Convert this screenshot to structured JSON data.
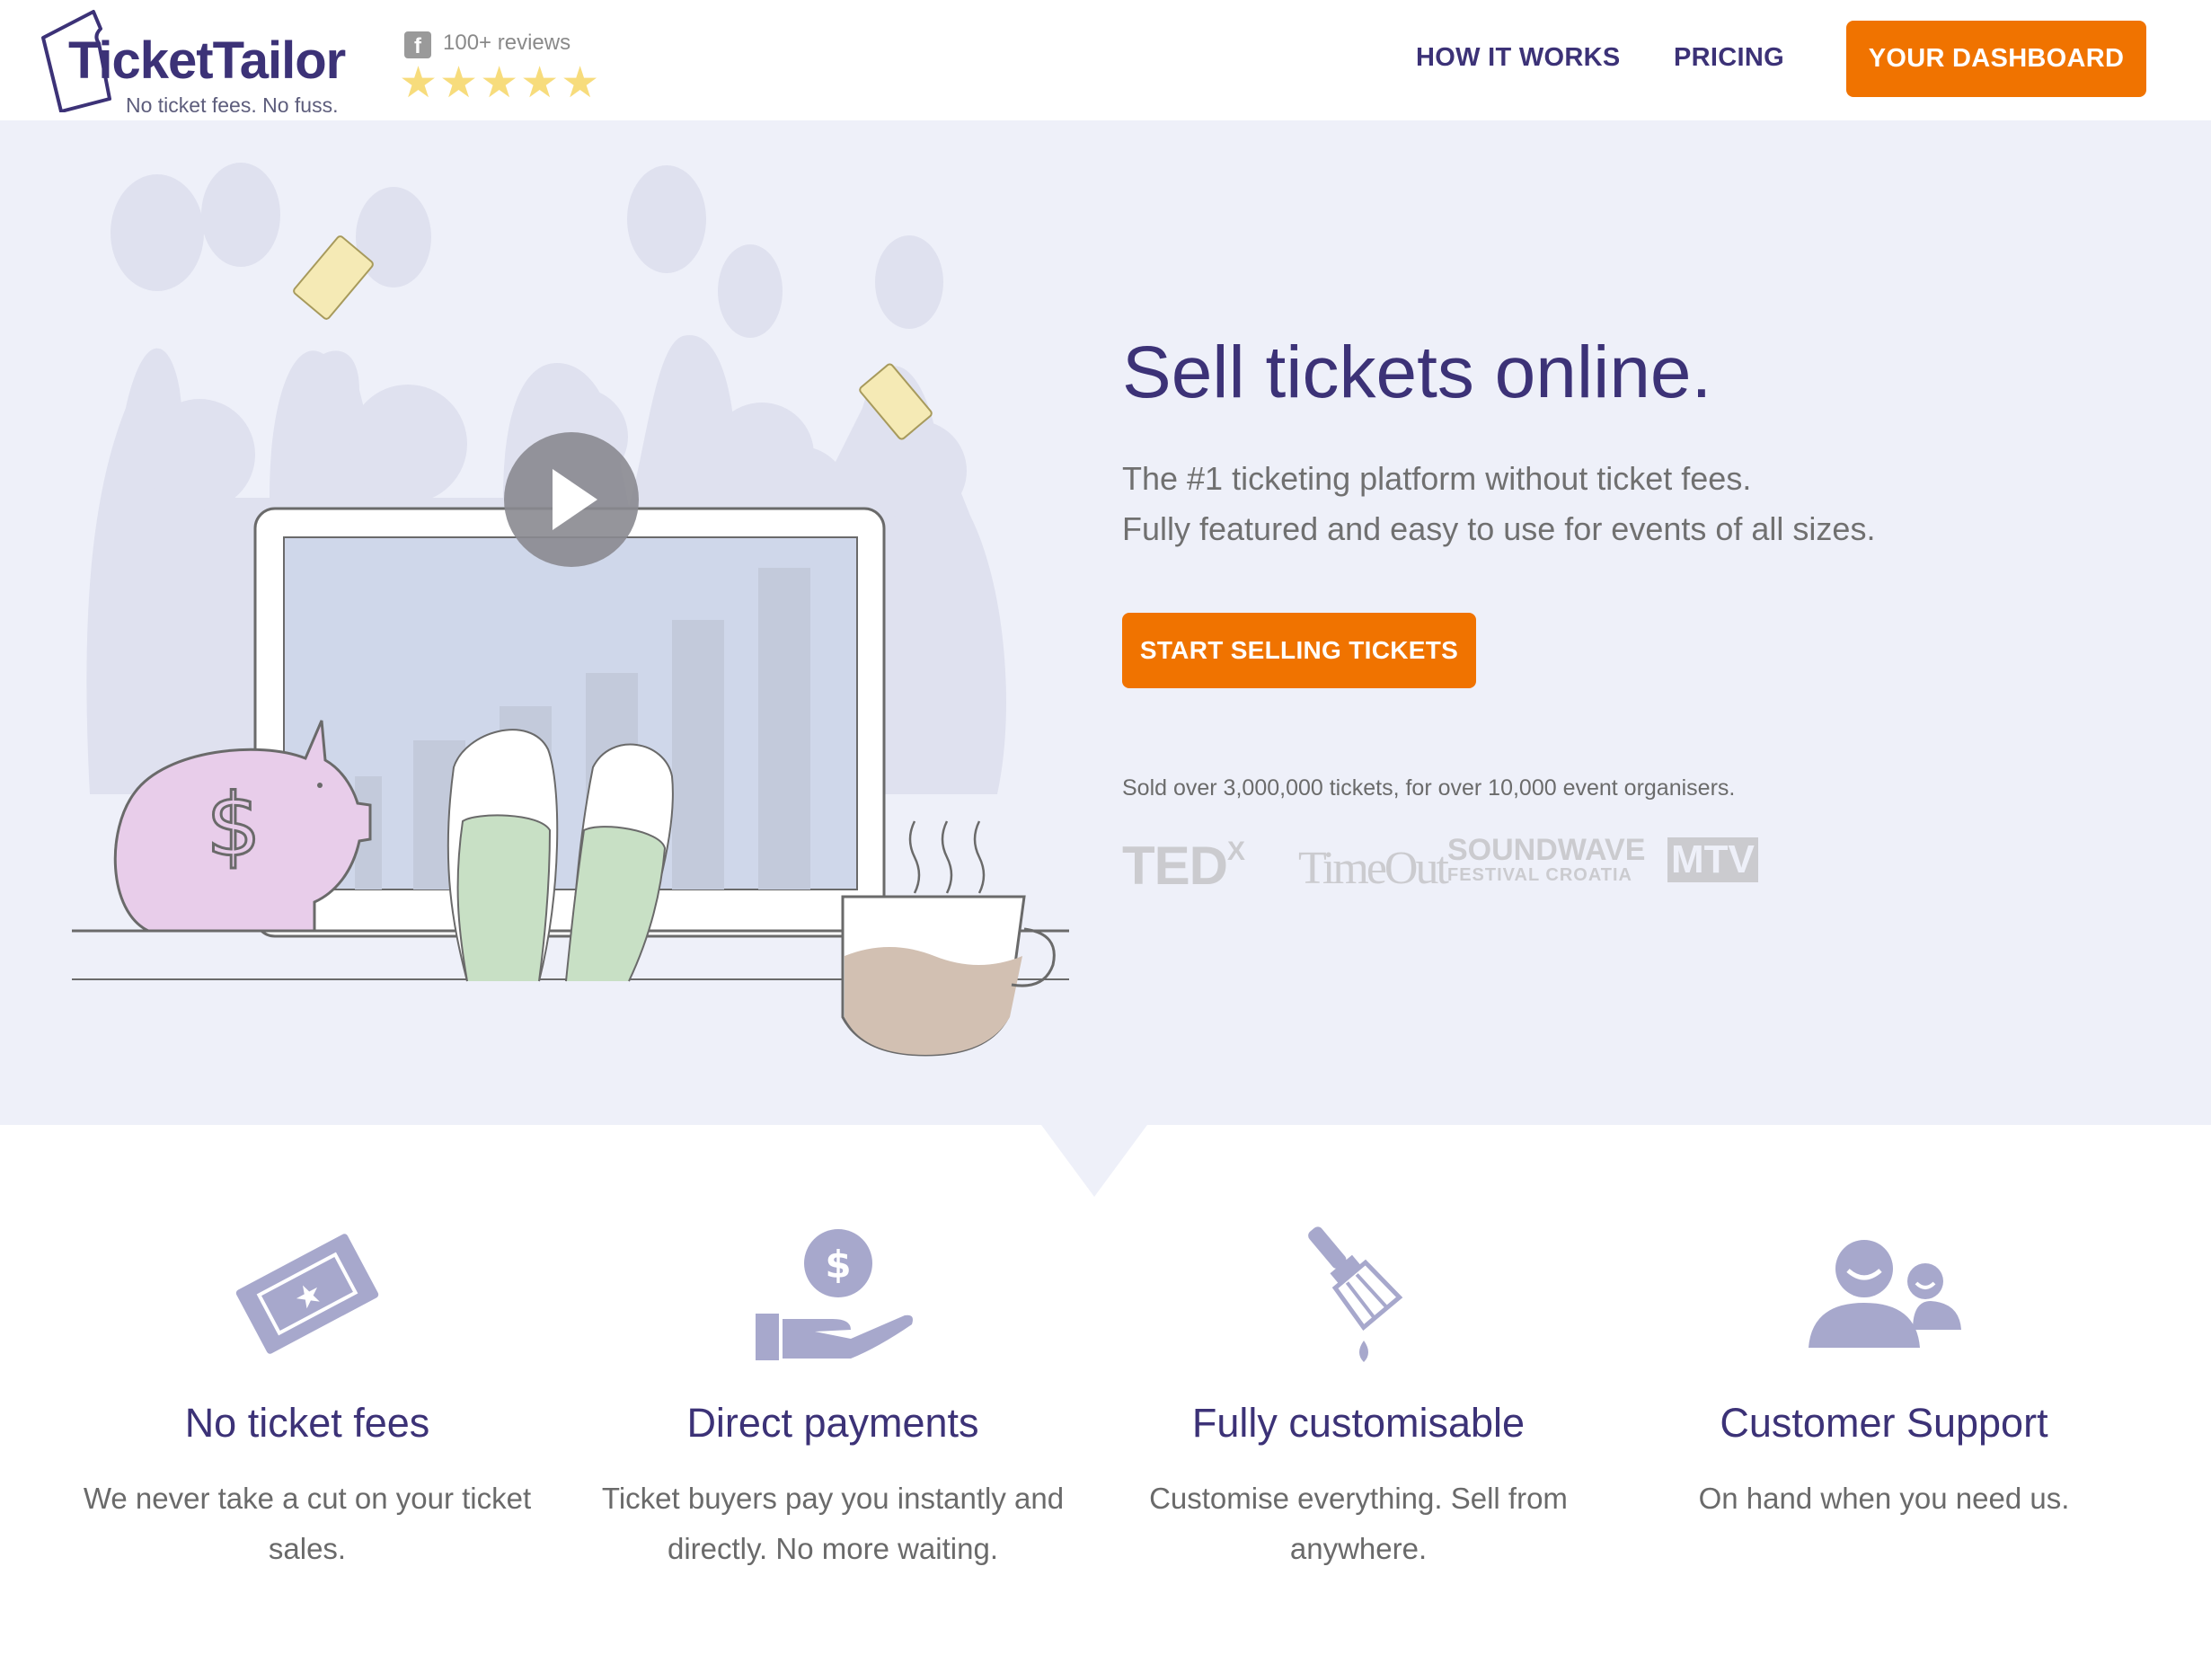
{
  "header": {
    "logo_name": "TicketTailor",
    "logo_tagline": "No ticket fees. No fuss.",
    "reviews_label": "100+ reviews",
    "facebook_glyph": "f",
    "stars": "★★★★★",
    "rating_stars": 5,
    "nav": {
      "how_it_works": "HOW IT WORKS",
      "pricing": "PRICING",
      "dashboard": "YOUR DASHBOARD"
    }
  },
  "hero": {
    "title": "Sell tickets online.",
    "subtitle_line1": "The #1 ticketing platform without ticket fees.",
    "subtitle_line2": "Fully featured and easy to use for events of all sizes.",
    "cta": "START SELLING TICKETS",
    "sold_text": "Sold over 3,000,000 tickets, for over 10,000 event organisers.",
    "brands": {
      "tedx_main": "TED",
      "tedx_sup": "X",
      "timeout": "TimeOut",
      "soundwave_top": "SOUNDWAVE",
      "soundwave_bottom": "FESTIVAL CROATIA",
      "mtv": "MTV"
    }
  },
  "features": [
    {
      "icon": "ticket-icon",
      "title": "No ticket fees",
      "text": "We never take a cut on your ticket sales."
    },
    {
      "icon": "payment-hand-icon",
      "title": "Direct payments",
      "text": "Ticket buyers pay you instantly and directly. No more waiting."
    },
    {
      "icon": "paint-brush-icon",
      "title": "Fully customisable",
      "text": "Customise everything. Sell from anywhere."
    },
    {
      "icon": "support-people-icon",
      "title": "Customer Support",
      "text": "On hand when you need us."
    }
  ],
  "colors": {
    "brand_purple": "#3c3277",
    "accent_orange": "#f07300",
    "hero_background": "#eef0f9",
    "icon_lavender": "#a7a8cc",
    "star_yellow": "#f7dc7c"
  }
}
